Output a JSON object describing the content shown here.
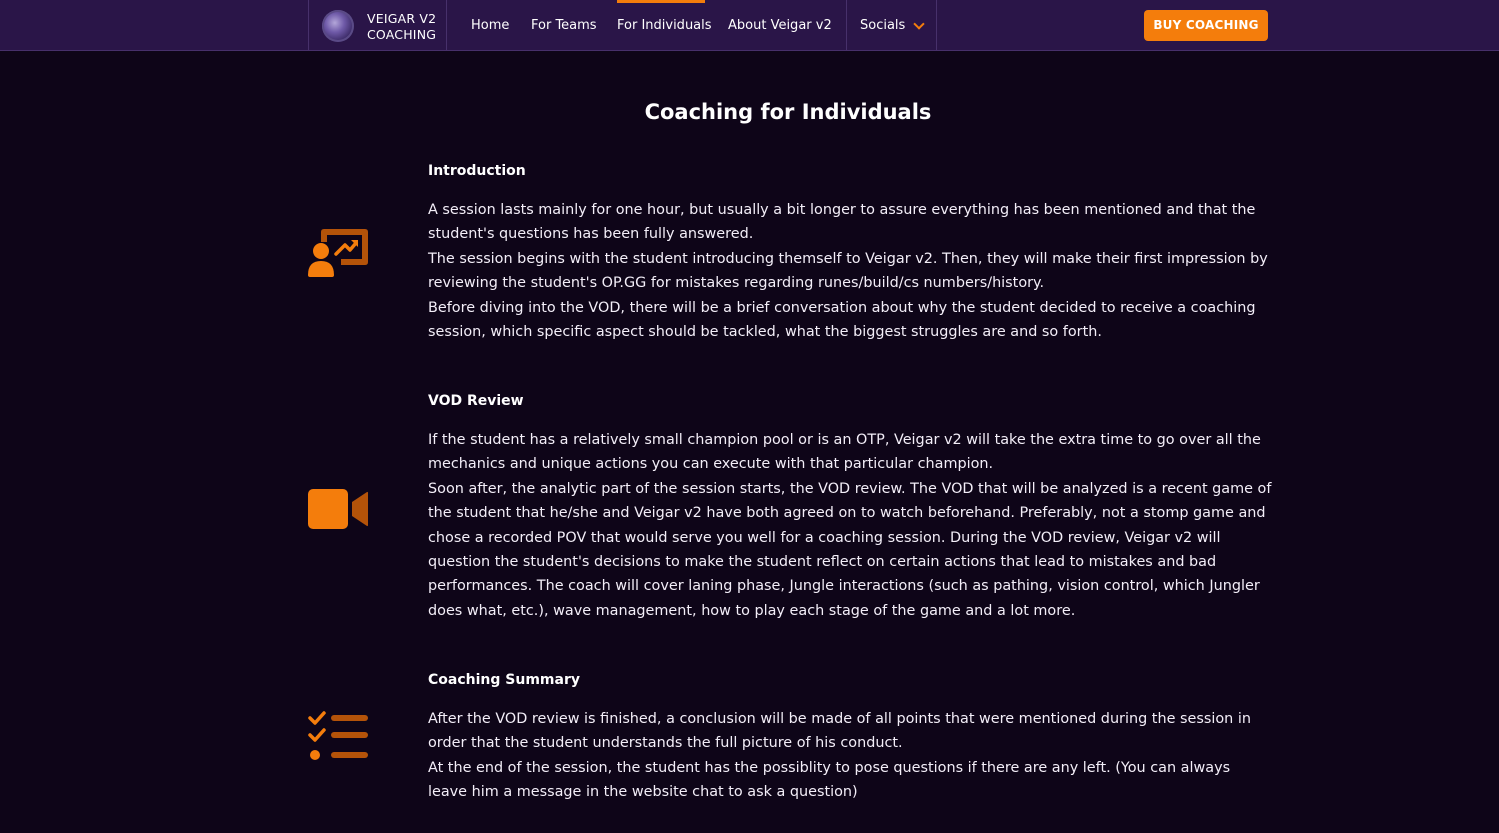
{
  "brand": {
    "line1": "VEIGAR V2",
    "line2": "COACHING"
  },
  "nav": {
    "items": [
      {
        "label": "Home"
      },
      {
        "label": "For Teams"
      },
      {
        "label": "For Individuals",
        "active": true
      },
      {
        "label": "About Veigar v2"
      }
    ],
    "socials_label": "Socials",
    "buy_button": "BUY COACHING"
  },
  "colors": {
    "accent": "#f47d0c",
    "accent_dark": "#b45309",
    "header_bg": "#2a1548",
    "page_bg": "#0e0518"
  },
  "main": {
    "title": "Coaching for Individuals",
    "sections": [
      {
        "heading": "Introduction",
        "icon": "presentation-icon",
        "paragraphs": [
          "A session lasts mainly for one hour, but usually a bit longer to assure everything has been mentioned and that the student's questions has been fully answered.",
          "The session begins with the student introducing themself to Veigar v2. Then, they will make their first impression by reviewing the student's OP.GG for mistakes regarding runes/build/cs numbers/history.",
          "Before diving into the VOD, there will be a brief conversation about why the student decided to receive a coaching session, which specific aspect should be tackled, what the biggest struggles are and so forth."
        ]
      },
      {
        "heading": "VOD Review",
        "icon": "video-camera-icon",
        "paragraphs": [
          "If the student has a relatively small champion pool or is an OTP, Veigar v2 will take the extra time to go over all the mechanics and unique actions you can execute with that particular champion.",
          "Soon after, the analytic part of the session starts, the VOD review. The VOD that will be analyzed is a recent game of the student that he/she and Veigar v2 have both agreed on to watch beforehand. Preferably, not a stomp game and chose a recorded POV that would serve you well for a coaching session. During the VOD review, Veigar v2 will question the student's decisions to make the student reflect on certain actions that lead to mistakes and bad performances. The coach will cover laning phase, Jungle interactions (such as pathing, vision control, which Jungler does what, etc.), wave management, how to play each stage of the game and a lot more."
        ]
      },
      {
        "heading": "Coaching Summary",
        "icon": "checklist-icon",
        "paragraphs": [
          "After the VOD review is finished, a conclusion will be made of all points that were mentioned during the session in order that the student understands the full picture of his conduct.",
          "At the end of the session, the student has the possiblity to pose questions if there are any left. (You can always leave him a message in the website chat to ask a question)"
        ]
      }
    ]
  }
}
